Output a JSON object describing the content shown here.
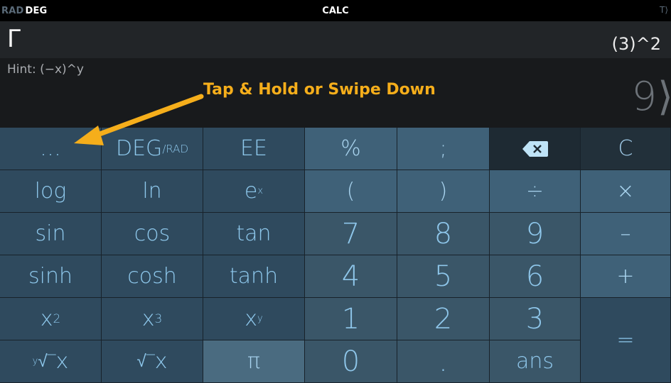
{
  "statusbar": {
    "mode_inactive": "RAD",
    "mode_active": "DEG",
    "title": "CALC",
    "right_glyph": "T⟩"
  },
  "display": {
    "function_glyph": "Γ",
    "expression": "(3)^2",
    "hint": "Hint: (−x)^y",
    "result": "9⟩"
  },
  "annotation": {
    "text": "Tap & Hold or Swipe Down",
    "color": "#f5ae1b"
  },
  "keys": {
    "more": "…",
    "deg_main": "DEG",
    "deg_sub": "/RAD",
    "ee": "EE",
    "percent": "%",
    "semicolon": ";",
    "backspace_icon": "backspace-icon",
    "clear": "C",
    "log": "log",
    "ln": "ln",
    "exp_base": "e",
    "exp_sup": "x",
    "open_paren": "(",
    "close_paren": ")",
    "divide": "÷",
    "multiply": "×",
    "sin": "sin",
    "cos": "cos",
    "tan": "tan",
    "seven": "7",
    "eight": "8",
    "nine": "9",
    "minus": "–",
    "sinh": "sinh",
    "cosh": "cosh",
    "tanh": "tanh",
    "four": "4",
    "five": "5",
    "six": "6",
    "plus": "+",
    "x2_base": "x",
    "x2_sup": "2",
    "x3_base": "x",
    "x3_sup": "3",
    "xy_base": "x",
    "xy_sup": "y",
    "one": "1",
    "two": "2",
    "three": "3",
    "equals": "=",
    "yroot_sup": "y",
    "yroot_radical": "√‾",
    "yroot_x": "x",
    "sqrt_radical": "√‾",
    "sqrt_x": "x",
    "pi": "π",
    "zero": "0",
    "decimal": ".",
    "ans": "ans"
  },
  "colors": {
    "accent": "#f5ae1b",
    "key_text": "#8ec8ec"
  }
}
